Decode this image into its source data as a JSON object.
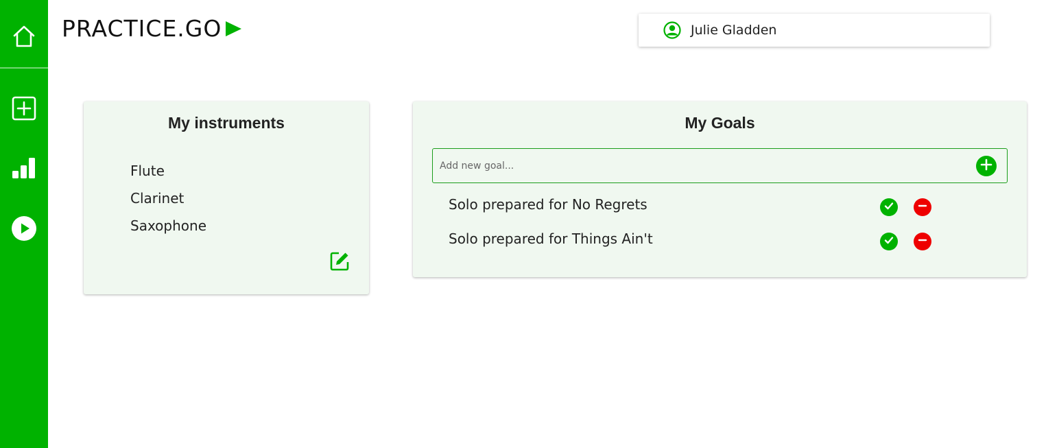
{
  "app": {
    "logo_text": "PRACTICE.GO"
  },
  "sidebar": {
    "items": [
      {
        "name": "home",
        "icon": "home-icon"
      },
      {
        "name": "add",
        "icon": "plus-square-icon"
      },
      {
        "name": "stats",
        "icon": "bar-chart-icon"
      },
      {
        "name": "play",
        "icon": "play-circle-icon"
      }
    ]
  },
  "user": {
    "name": "Julie Gladden",
    "icon": "account-circle-icon"
  },
  "instruments": {
    "title": "My instruments",
    "items": [
      "Flute",
      "Clarinet",
      "Saxophone"
    ],
    "edit_icon": "edit-icon"
  },
  "goals": {
    "title": "My Goals",
    "input_placeholder": "Add new goal...",
    "input_value": "",
    "items": [
      {
        "text": "Solo prepared for No Regrets"
      },
      {
        "text": "Solo prepared for Things Ain't"
      }
    ]
  },
  "colors": {
    "brand_green": "#00b200",
    "card_background": "#f0f8f0",
    "remove_red": "#ee0000"
  }
}
